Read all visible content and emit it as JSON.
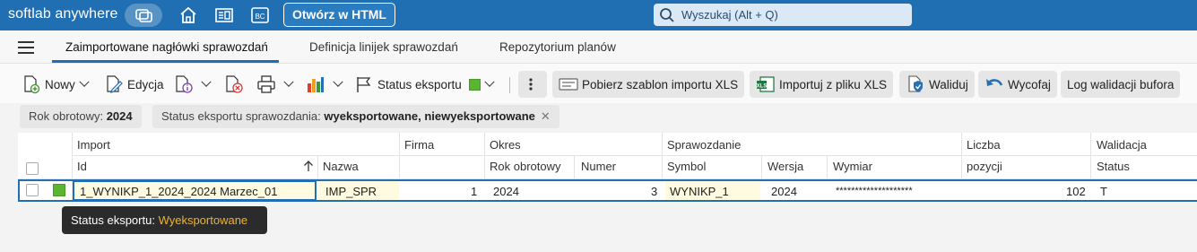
{
  "app": {
    "brand": "softlab anywhere",
    "open_html": "Otwórz w HTML",
    "search_placeholder": "Wyszukaj (Alt + Q)"
  },
  "tabs": [
    {
      "label": "Zaimportowane nagłówki sprawozdań"
    },
    {
      "label": "Definicja linijek sprawozdań"
    },
    {
      "label": "Repozytorium planów"
    }
  ],
  "toolbar": {
    "new_label": "Nowy",
    "edit_label": "Edycja",
    "export_status_label": "Status eksportu",
    "download_template_label": "Pobierz szablon importu XLS",
    "import_xls_label": "Importuj z pliku XLS",
    "validate_label": "Waliduj",
    "revoke_label": "Wycofaj",
    "buffer_log_label": "Log walidacji bufora"
  },
  "filters": [
    {
      "key": "Rok obrotowy: ",
      "value": "2024"
    },
    {
      "key": "Status eksportu sprawozdania: ",
      "value": "wyeksportowane, niewyeksportowane"
    }
  ],
  "grid": {
    "groups": {
      "import": "Import",
      "firma": "Firma",
      "okres": "Okres",
      "sprawozdanie": "Sprawozdanie",
      "liczba": "Liczba",
      "walidacja": "Walidacja"
    },
    "columns": {
      "id": "Id",
      "nazwa": "Nazwa",
      "rok": "Rok obrotowy",
      "numer": "Numer",
      "symbol": "Symbol",
      "wersja": "Wersja",
      "wymiar": "Wymiar",
      "pozycji": "pozycji",
      "status": "Status"
    },
    "rows": [
      {
        "id": "1_WYNIKP_1_2024_2024 Marzec_01",
        "nazwa": "IMP_SPR",
        "firma": "1",
        "rok": "2024",
        "numer": "3",
        "symbol": "WYNIKP_1",
        "wersja": "2024",
        "wymiar": "********************",
        "pozycji": "102",
        "status": "T"
      }
    ]
  },
  "tooltip": {
    "label": "Status eksportu: ",
    "value": "Wyeksportowane"
  },
  "colors": {
    "topbar": "#1f6fb2",
    "accent": "#1f6fb2",
    "export_green": "#5cb531",
    "tooltip_value": "#f0b429"
  }
}
